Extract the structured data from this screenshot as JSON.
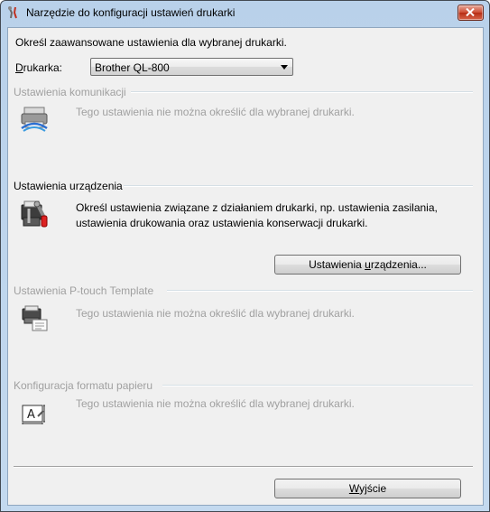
{
  "window": {
    "title": "Narzędzie do konfiguracji ustawień drukarki"
  },
  "intro_text": "Określ zaawansowane ustawienia dla wybranej drukarki.",
  "printer": {
    "label_underlined": "D",
    "label_rest": "rukarka:",
    "selected": "Brother QL-800"
  },
  "sections": {
    "communication": {
      "title": "Ustawienia komunikacji",
      "description": "Tego ustawienia nie można określić dla wybranej drukarki.",
      "enabled": false
    },
    "device": {
      "title": "Ustawienia urządzenia",
      "description_line1": "Określ ustawienia związane z działaniem drukarki, np. ustawienia zasilania,",
      "description_line2": "ustawienia drukowania oraz ustawienia konserwacji drukarki.",
      "button_prefix": "Ustawienia ",
      "button_underlined": "u",
      "button_suffix": "rządzenia...",
      "enabled": true
    },
    "ptouch": {
      "title": "Ustawienia P-touch Template",
      "description": "Tego ustawienia nie można określić dla wybranej drukarki.",
      "enabled": false
    },
    "paper": {
      "title": "Konfiguracja formatu papieru",
      "description": "Tego ustawienia nie można określić dla wybranej drukarki.",
      "enabled": false
    }
  },
  "exit_button": {
    "underlined": "W",
    "rest": "yjście"
  },
  "colors": {
    "accent": "#b9d1ea",
    "disabled_text": "#a0a0a0",
    "close_red": "#c7432a"
  },
  "icons": {
    "app": "printer-tool-icon",
    "communication": "printer-network-icon",
    "device": "printer-tools-icon",
    "ptouch": "printer-template-icon",
    "paper": "paper-format-icon"
  }
}
